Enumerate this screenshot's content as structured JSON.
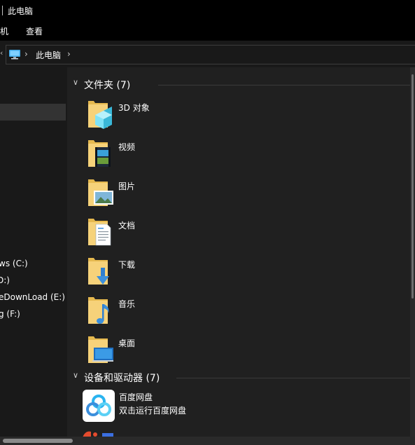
{
  "window": {
    "title": "此电脑"
  },
  "ribbon": {
    "tabs": [
      "机",
      "查看"
    ]
  },
  "address": {
    "crumb": "此电脑"
  },
  "nav": {
    "items": [
      "ws (C:)",
      "D:)",
      "eDownLoad (E:)",
      "g (F:)"
    ]
  },
  "groups": {
    "folders": {
      "label": "文件夹 (7)"
    },
    "drives": {
      "label": "设备和驱动器 (7)"
    }
  },
  "folders": [
    {
      "name": "3D 对象",
      "icon": "3d-objects-folder-icon"
    },
    {
      "name": "视频",
      "icon": "videos-folder-icon"
    },
    {
      "name": "图片",
      "icon": "pictures-folder-icon"
    },
    {
      "name": "文档",
      "icon": "documents-folder-icon"
    },
    {
      "name": "下载",
      "icon": "downloads-folder-icon"
    },
    {
      "name": "音乐",
      "icon": "music-folder-icon"
    },
    {
      "name": "桌面",
      "icon": "desktop-folder-icon"
    }
  ],
  "drives": [
    {
      "name": "百度网盘",
      "desc": "双击运行百度网盘",
      "icon": "baidu-netdisk-icon"
    },
    {
      "icon": "app-icon"
    }
  ],
  "colors": {
    "folder": "#f6d27a",
    "accent": "#3b8fdc",
    "content_bg": "#202020",
    "nav_bg": "#191919"
  }
}
